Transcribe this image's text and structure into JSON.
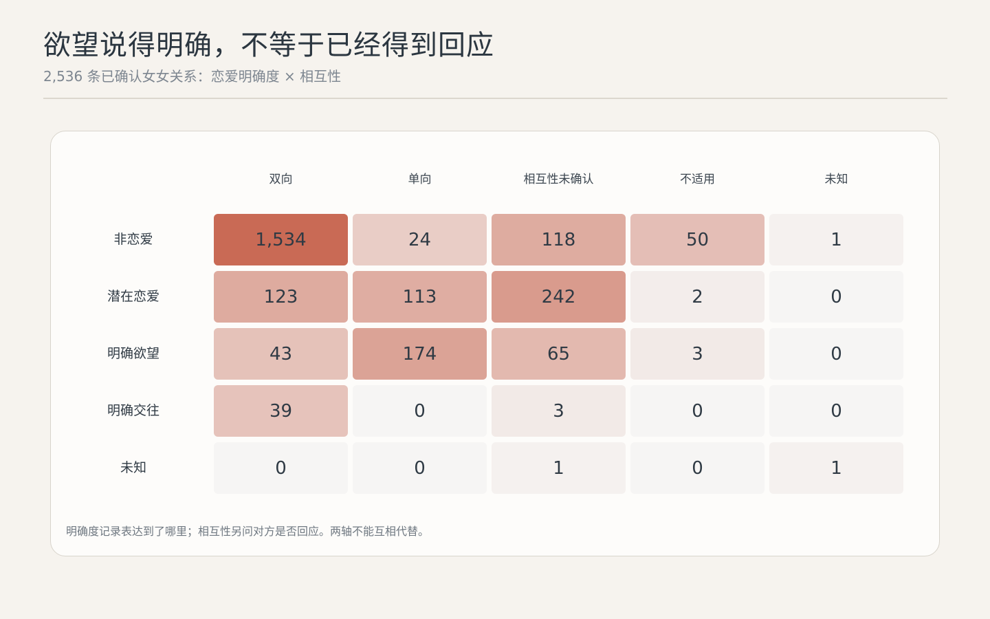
{
  "header": {
    "title": "欲望说得明确，不等于已经得到回应",
    "subtitle": "2,536 条已确认女女关系：恋爱明确度 × 相互性"
  },
  "note": "明确度记录表达到了哪里；相互性另问对方是否回应。两轴不能互相代替。",
  "colors": {
    "high": "#c96a55",
    "low": "#f6f5f4",
    "text_dark": "#2f3a44",
    "text_light": "#3a2b27"
  },
  "chart_data": {
    "type": "heatmap",
    "title": "欲望说得明确，不等于已经得到回应",
    "subtitle": "2,536 条已确认女女关系：恋爱明确度 × 相互性",
    "columns": [
      "双向",
      "单向",
      "相互性未确认",
      "不适用",
      "未知"
    ],
    "rows": [
      "非恋爱",
      "潜在恋爱",
      "明确欲望",
      "明确交往",
      "未知"
    ],
    "values": [
      [
        1534,
        24,
        118,
        50,
        1
      ],
      [
        123,
        113,
        242,
        2,
        0
      ],
      [
        43,
        174,
        65,
        3,
        0
      ],
      [
        39,
        0,
        3,
        0,
        0
      ],
      [
        0,
        0,
        1,
        0,
        1
      ]
    ],
    "display_values": [
      [
        "1,534",
        "24",
        "118",
        "50",
        "1"
      ],
      [
        "123",
        "113",
        "242",
        "2",
        "0"
      ],
      [
        "43",
        "174",
        "65",
        "3",
        "0"
      ],
      [
        "39",
        "0",
        "3",
        "0",
        "0"
      ],
      [
        "0",
        "0",
        "1",
        "0",
        "1"
      ]
    ],
    "color_scale": "log"
  }
}
